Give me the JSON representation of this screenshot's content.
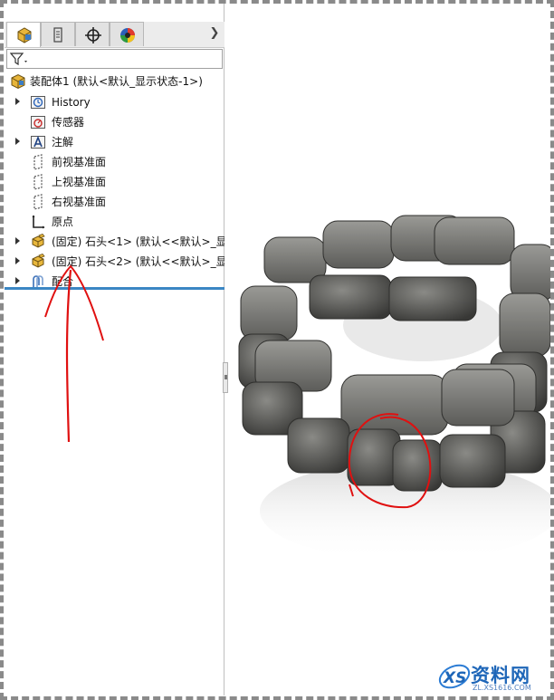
{
  "tree": {
    "root": {
      "label": "装配体1  (默认<默认_显示状态-1>)"
    },
    "items": [
      {
        "label": "History",
        "icon": "history-icon",
        "expandable": true
      },
      {
        "label": "传感器",
        "icon": "sensor-icon",
        "expandable": false
      },
      {
        "label": "注解",
        "icon": "annotation-icon",
        "expandable": true
      },
      {
        "label": "前视基准面",
        "icon": "plane-icon",
        "expandable": false
      },
      {
        "label": "上视基准面",
        "icon": "plane-icon",
        "expandable": false
      },
      {
        "label": "右视基准面",
        "icon": "plane-icon",
        "expandable": false
      },
      {
        "label": "原点",
        "icon": "origin-icon",
        "expandable": false
      },
      {
        "label": "(固定) 石头<1> (默认<<默认>_显示",
        "icon": "part-icon",
        "expandable": true
      },
      {
        "label": "(固定) 石头<2> (默认<<默认>_显示",
        "icon": "part-icon",
        "expandable": true
      },
      {
        "label": "配合",
        "icon": "mates-icon",
        "expandable": true
      }
    ]
  },
  "tabs": [
    {
      "name": "feature-manager",
      "icon": "feature-tree-icon"
    },
    {
      "name": "property-manager",
      "icon": "property-icon"
    },
    {
      "name": "configuration-manager",
      "icon": "crosshair-icon"
    },
    {
      "name": "display-manager",
      "icon": "color-wheel-icon"
    }
  ],
  "watermark": {
    "brand": "资料网",
    "url": "ZL.XS1616.COM"
  },
  "colors": {
    "accent": "#3b86c4",
    "annotation": "#e01010",
    "stone": "#5a5a58"
  }
}
